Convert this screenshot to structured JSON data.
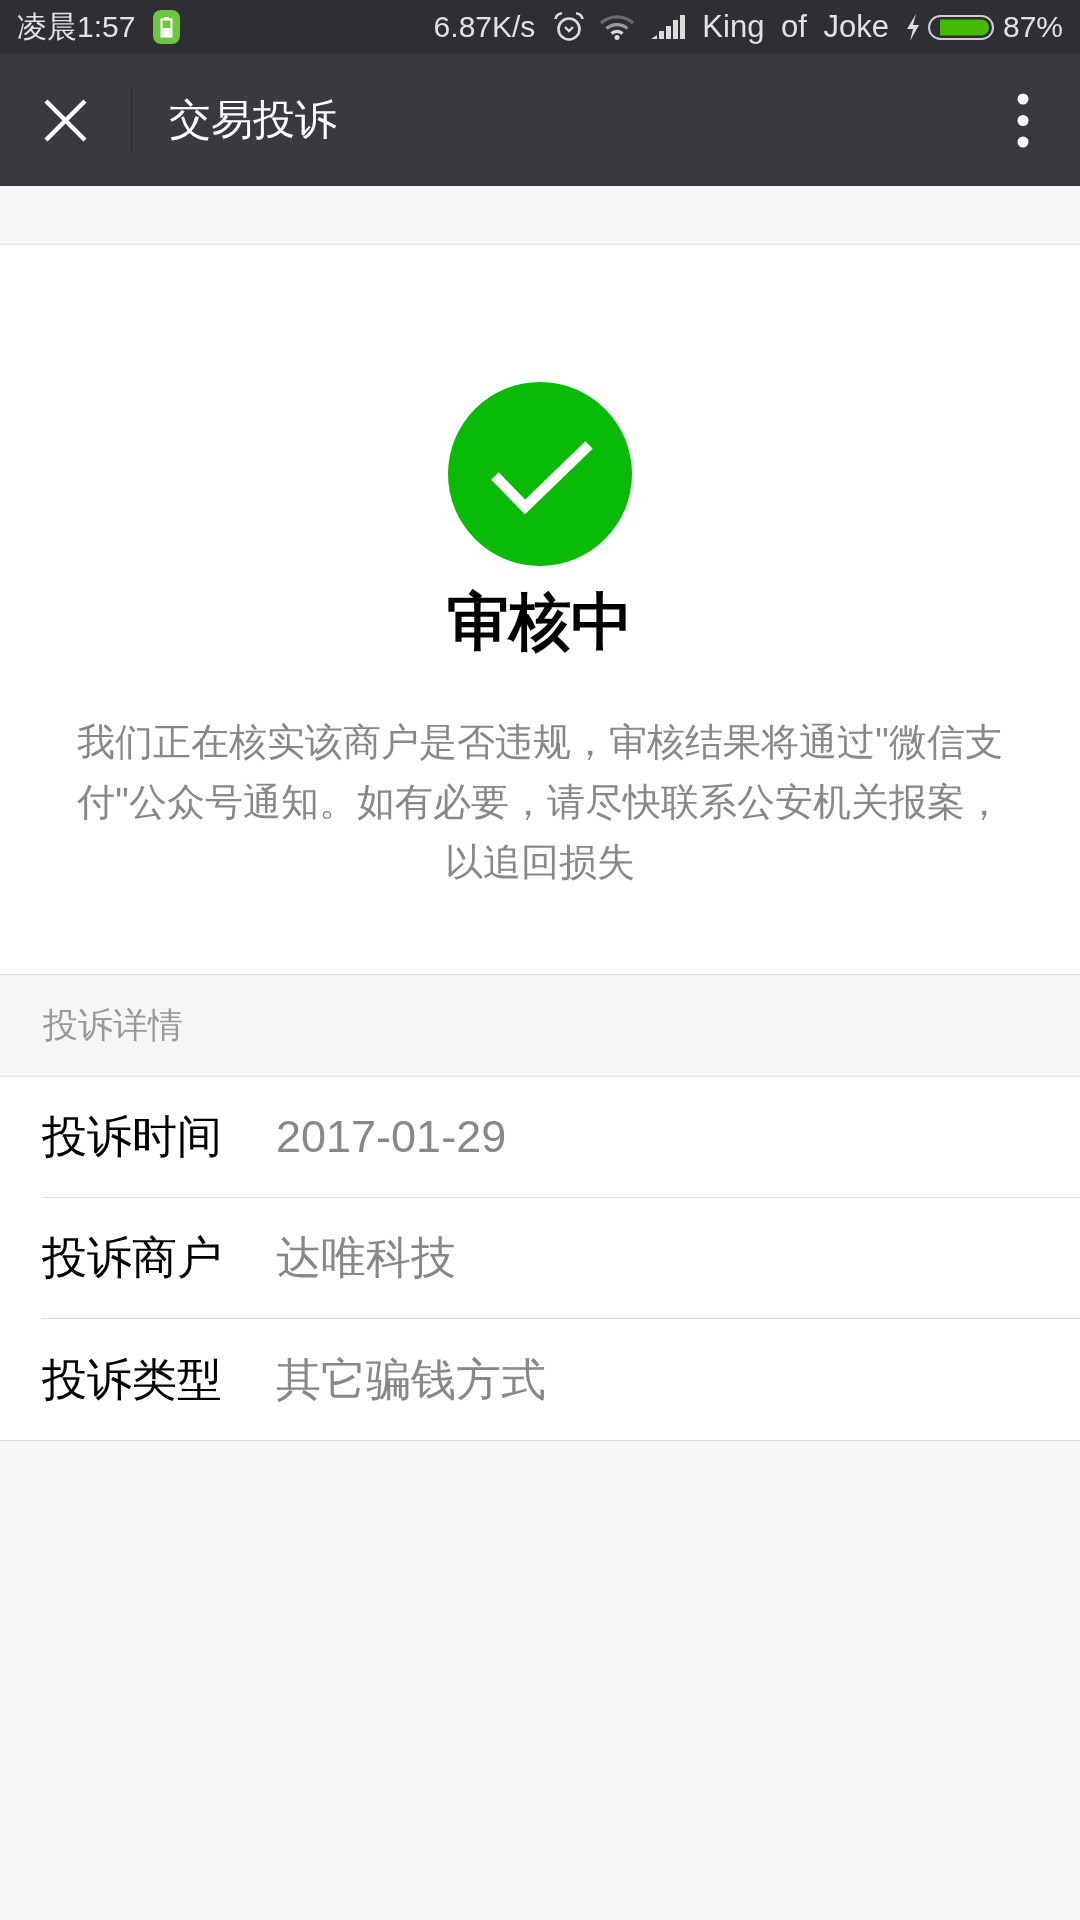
{
  "status_bar": {
    "time": "凌晨1:57",
    "network_speed": "6.87K/s",
    "carrier": "King of Joke",
    "charging": true,
    "battery_percent": "87%"
  },
  "nav_bar": {
    "title": "交易投诉"
  },
  "result": {
    "title": "审核中",
    "description": "我们正在核实该商户是否违规，审核结果将通过\"微信支付\"公众号通知。如有必要，请尽快联系公安机关报案，以追回损失"
  },
  "details": {
    "header": "投诉详情",
    "rows": [
      {
        "label": "投诉时间",
        "value": "2017-01-29"
      },
      {
        "label": "投诉商户",
        "value": "达唯科技"
      },
      {
        "label": "投诉类型",
        "value": "其它骗钱方式"
      }
    ]
  }
}
